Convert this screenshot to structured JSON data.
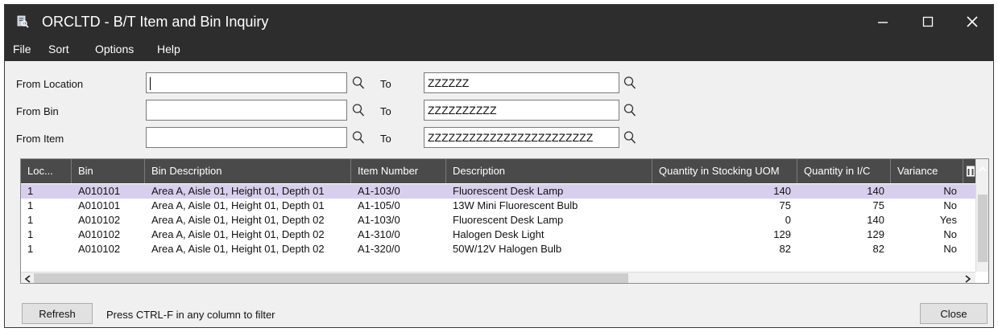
{
  "window": {
    "title": "ORCLTD - B/T Item and Bin Inquiry",
    "controls": {
      "minimize": "—",
      "maximize": "☐",
      "close": "✕"
    }
  },
  "menu": {
    "file": "File",
    "sort": "Sort",
    "options": "Options",
    "help": "Help"
  },
  "filters": {
    "to_label": "To",
    "location": {
      "label": "From Location",
      "from_value": "",
      "to_value": "ZZZZZZ"
    },
    "bin": {
      "label": "From Bin",
      "from_value": "",
      "to_value": "ZZZZZZZZZZ"
    },
    "item": {
      "label": "From Item",
      "from_value": "",
      "to_value": "ZZZZZZZZZZZZZZZZZZZZZZZZ"
    }
  },
  "grid": {
    "columns": [
      "Loc...",
      "Bin",
      "Bin Description",
      "Item Number",
      "Description",
      "Quantity in Stocking UOM",
      "Quantity in I/C",
      "Variance"
    ],
    "rows": [
      [
        "1",
        "A010101",
        "Area A, Aisle 01, Height 01, Depth 01",
        "A1-103/0",
        "Fluorescent Desk Lamp",
        "140",
        "140",
        "No"
      ],
      [
        "1",
        "A010101",
        "Area A, Aisle 01, Height 01, Depth 01",
        "A1-105/0",
        "13W Mini Fluorescent Bulb",
        "75",
        "75",
        "No"
      ],
      [
        "1",
        "A010102",
        "Area A, Aisle 01, Height 01, Depth 02",
        "A1-103/0",
        "Fluorescent Desk Lamp",
        "0",
        "140",
        "Yes"
      ],
      [
        "1",
        "A010102",
        "Area A, Aisle 01, Height 01, Depth 02",
        "A1-310/0",
        "Halogen Desk Light",
        "129",
        "129",
        "No"
      ],
      [
        "1",
        "A010102",
        "Area A, Aisle 01, Height 01, Depth 02",
        "A1-320/0",
        "50W/12V Halogen Bulb",
        "82",
        "82",
        "No"
      ]
    ],
    "selected_row_index": 0
  },
  "footer": {
    "refresh_label": "Refresh",
    "hint": "Press CTRL-F in any column to filter",
    "close_label": "Close"
  },
  "colors": {
    "titlebar": "#2d2d2d",
    "header": "#4a4a4a",
    "selected_row": "#d7d0ec"
  },
  "icons": [
    "app-icon",
    "search-icon",
    "column-chooser-icon"
  ]
}
